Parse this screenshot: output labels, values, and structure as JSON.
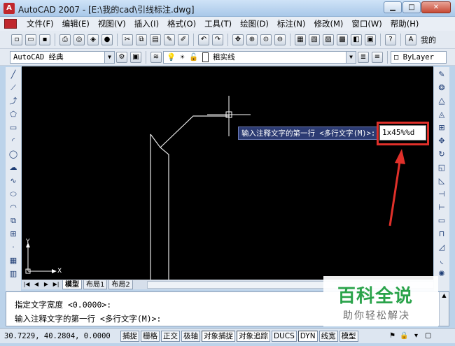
{
  "window": {
    "title": "AutoCAD 2007 - [E:\\我的cad\\引线标注.dwg]",
    "logo_text": "A"
  },
  "menu": [
    "文件(F)",
    "编辑(E)",
    "视图(V)",
    "插入(I)",
    "格式(O)",
    "工具(T)",
    "绘图(D)",
    "标注(N)",
    "修改(M)",
    "窗口(W)",
    "帮助(H)"
  ],
  "toolbar": {
    "help_tail": "我的"
  },
  "workspace": {
    "name": "AutoCAD 经典",
    "linetype": "粗实线",
    "color": "ByLayer"
  },
  "drawing": {
    "prompt": "输入注释文字的第一行 <多行文字(M)>:",
    "input_value": "1x45%%d",
    "ucs_x": "X",
    "ucs_y": "Y"
  },
  "tabs": [
    "模型",
    "布局1",
    "布局2"
  ],
  "command": {
    "line1": "指定文字宽度 <0.0000>:",
    "line2": "输入注释文字的第一行 <多行文字(M)>:"
  },
  "status": {
    "coords": "30.7229, 40.2804, 0.0000",
    "buttons": [
      "捕捉",
      "栅格",
      "正交",
      "极轴",
      "对象捕捉",
      "对象追踪",
      "DUCS",
      "DYN",
      "线宽",
      "模型"
    ]
  },
  "watermark": {
    "title": "百科全说",
    "subtitle": "助你轻松解决"
  },
  "colors": {
    "canvas": "#000000",
    "highlight": "#e0302a",
    "watermark_green": "#2aa34a"
  }
}
